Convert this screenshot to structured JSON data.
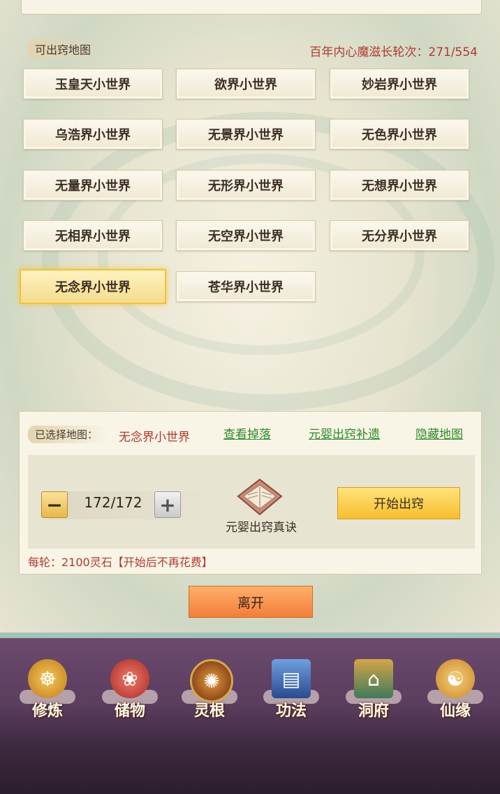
{
  "header": {
    "section_label": "可出窍地图",
    "rounds_text": "百年内心魔滋长轮次：271/554"
  },
  "maps": [
    {
      "label": "玉皇天小世界",
      "selected": false
    },
    {
      "label": "欲界小世界",
      "selected": false
    },
    {
      "label": "妙岩界小世界",
      "selected": false
    },
    {
      "label": "乌浩界小世界",
      "selected": false
    },
    {
      "label": "无景界小世界",
      "selected": false
    },
    {
      "label": "无色界小世界",
      "selected": false
    },
    {
      "label": "无量界小世界",
      "selected": false
    },
    {
      "label": "无形界小世界",
      "selected": false
    },
    {
      "label": "无想界小世界",
      "selected": false
    },
    {
      "label": "无相界小世界",
      "selected": false
    },
    {
      "label": "无空界小世界",
      "selected": false
    },
    {
      "label": "无分界小世界",
      "selected": false
    },
    {
      "label": "无念界小世界",
      "selected": true
    },
    {
      "label": "苍华界小世界",
      "selected": false
    }
  ],
  "selection": {
    "label": "已选择地图：",
    "value": "无念界小世界",
    "links": {
      "drops": "查看掉落",
      "compensation": "元婴出窍补遗",
      "hide_map": "隐藏地图"
    }
  },
  "stepper": {
    "minus": "−",
    "plus": "+",
    "value": "172/172"
  },
  "item": {
    "icon": "book-icon",
    "label": "元婴出窍真诀"
  },
  "start_button": "开始出窍",
  "cost_text": "每轮：2100灵石【开始后不再花费】",
  "leave_button": "离开",
  "nav": [
    {
      "label": "修炼",
      "icon": "meditating-figure-icon",
      "color": "#d89a2a"
    },
    {
      "label": "储物",
      "icon": "treasure-bag-icon",
      "color": "#c8433a"
    },
    {
      "label": "灵根",
      "icon": "swirl-orb-icon",
      "color": "#8a4a1e"
    },
    {
      "label": "功法",
      "icon": "book-stack-icon",
      "color": "#3a6ab0"
    },
    {
      "label": "洞府",
      "icon": "pavilion-icon",
      "color": "#3e7a5a"
    },
    {
      "label": "仙缘",
      "icon": "gourd-yinyang-icon",
      "color": "#c9862a"
    }
  ],
  "colors": {
    "accent_red": "#b03a30",
    "link_green": "#2e8a28",
    "gold": "#f7be2f"
  }
}
